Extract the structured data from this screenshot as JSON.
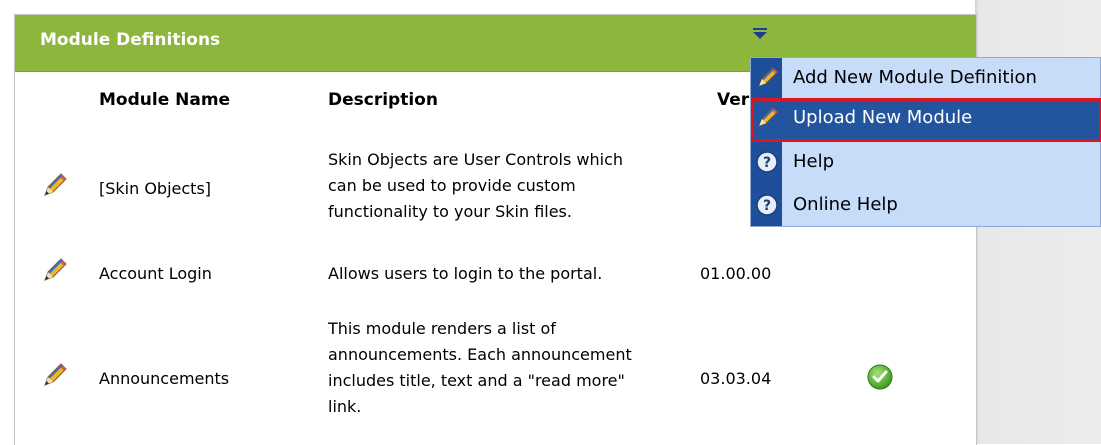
{
  "panel": {
    "title": "Module Definitions"
  },
  "table": {
    "headers": {
      "name": "Module Name",
      "description": "Description",
      "version": "Version"
    },
    "rows": [
      {
        "name": "[Skin Objects]",
        "description_lines": [
          "Skin Objects are User Controls which",
          "can be used to provide custom",
          "functionality to your Skin files."
        ],
        "version": "",
        "premium": false
      },
      {
        "name": "Account Login",
        "description_lines": [
          "Allows users to login to the portal."
        ],
        "version": "01.00.00",
        "premium": false
      },
      {
        "name": "Announcements",
        "description_lines": [
          "This module renders a list of",
          "announcements. Each announcement",
          "includes title, text and a \"read more\"",
          "link."
        ],
        "version": "03.03.04",
        "premium": true
      }
    ]
  },
  "menu": {
    "items": [
      {
        "label": "Add New Module Definition",
        "icon": "pencil-icon"
      },
      {
        "label": "Upload New Module",
        "icon": "pencil-icon",
        "active": true
      },
      {
        "label": "Help",
        "icon": "help-icon"
      },
      {
        "label": "Online Help",
        "icon": "help-icon"
      }
    ]
  },
  "colors": {
    "header_green": "#8db63c",
    "menu_bg": "#c6dcf8",
    "menu_strip": "#1f4f9a",
    "active_item": "#23549e",
    "highlight_border": "#e0141e"
  }
}
